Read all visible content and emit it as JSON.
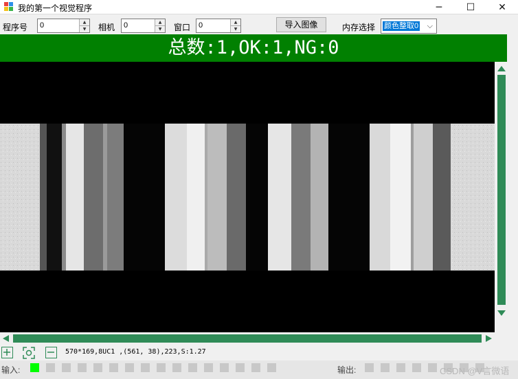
{
  "window": {
    "title": "我的第一个视觉程序",
    "minimize_glyph": "─",
    "maximize_glyph": "☐",
    "close_glyph": "✕",
    "icon": "app-icon"
  },
  "toolbar": {
    "program_label": "程序号",
    "program_value": "0",
    "camera_label": "相机",
    "camera_value": "0",
    "window_label": "窗口",
    "window_value": "0",
    "import_button": "导入图像",
    "memory_label": "内存选择",
    "memory_selected": "颜色整取0",
    "up_glyph": "▲",
    "down_glyph": "▼",
    "chevron_glyph": "⌵"
  },
  "banner": {
    "text": "总数:1,OK:1,NG:0",
    "background": "#018001"
  },
  "image_view": {
    "icon": "grayscale-camera-image",
    "size_text": "570*169,8UC1"
  },
  "status": {
    "text": "570*169,8UC1 ,(561, 38),223,S:1.27"
  },
  "tools": {
    "zoom_in": "zoom-in-icon",
    "fit": "fit-to-screen-icon",
    "zoom_out": "zoom-out-icon"
  },
  "io": {
    "input_label": "输入:",
    "output_label": "输出:",
    "inputs": [
      "on",
      "off",
      "off",
      "off",
      "off",
      "off",
      "off",
      "off",
      "off",
      "off",
      "off",
      "off",
      "off",
      "off",
      "off",
      "off"
    ],
    "outputs": [
      "off",
      "off",
      "off",
      "off",
      "off",
      "off",
      "off",
      "off"
    ],
    "on_color": "#00ff00",
    "off_color": "#c8c8c8"
  },
  "watermark": "CSDN @V言微语",
  "accent_color": "#2f8b57"
}
